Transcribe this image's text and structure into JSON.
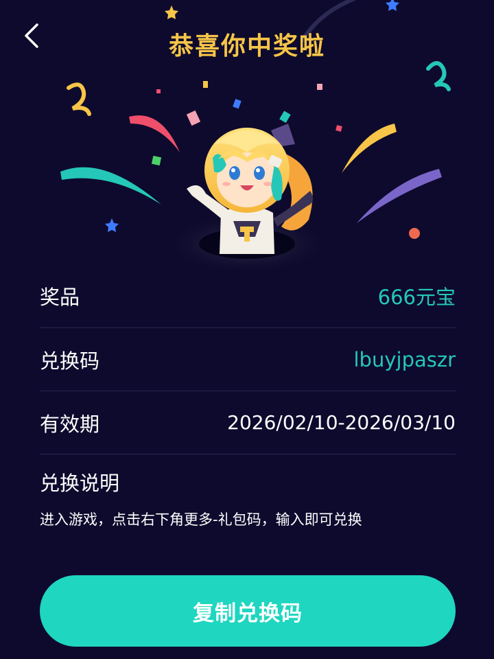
{
  "header": {
    "back_icon": "chevron-left-icon",
    "title": "恭喜你中奖啦"
  },
  "prize_details": {
    "rows": [
      {
        "label": "奖品",
        "value": "666元宝"
      },
      {
        "label": "兑换码",
        "value": "lbuyjpaszr"
      },
      {
        "label": "有效期",
        "value": "2026/02/10-2026/03/10"
      }
    ]
  },
  "instructions": {
    "title": "兑换说明",
    "text": "进入游戏，点击右下角更多-礼包码，输入即可兑换"
  },
  "actions": {
    "copy_button_label": "复制兑换码"
  },
  "colors": {
    "background": "#0e0a2d",
    "title_gold": "#f7c548",
    "accent_teal": "#25c7b8",
    "button_teal": "#1fd6c0",
    "divider": "#2a2650"
  }
}
